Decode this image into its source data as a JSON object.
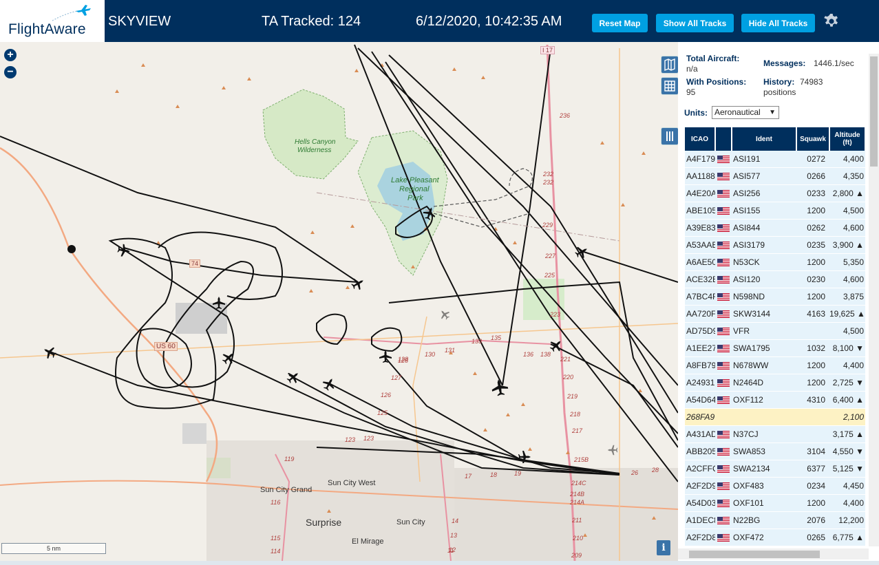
{
  "header": {
    "logo_text": "FlightAware",
    "app_name": "SKYVIEW",
    "tracked": "TA Tracked: 124",
    "datetime": "6/12/2020, 10:42:35 AM",
    "buttons": {
      "reset": "Reset Map",
      "show_all": "Show All Tracks",
      "hide_all": "Hide All Tracks"
    }
  },
  "map": {
    "zoom_in": "+",
    "zoom_out": "−",
    "scale": "5 nm",
    "info": "i",
    "labels": {
      "hells_canyon": "Hells Canyon",
      "wilderness": "Wilderness",
      "lake1": "Lake Pleasant",
      "lake2": "Regional",
      "lake3": "Park",
      "sun_city_grand": "Sun City Grand",
      "sun_city_west": "Sun City West",
      "surprise": "Surprise",
      "sun_city": "Sun City",
      "el_mirage": "El Mirage",
      "us60": "US 60",
      "i17": "I 17",
      "r74": "74"
    },
    "road_numbers": [
      "236",
      "232",
      "232",
      "229",
      "227",
      "225",
      "223",
      "221",
      "220",
      "219",
      "218",
      "217",
      "215B",
      "214C",
      "214B",
      "214A",
      "211",
      "210",
      "209",
      "131",
      "130",
      "128",
      "127",
      "126",
      "125",
      "123",
      "123",
      "135",
      "133",
      "138",
      "136",
      "119",
      "116",
      "115",
      "114",
      "17",
      "18",
      "19",
      "26",
      "28",
      "14",
      "13",
      "12",
      "11",
      "128"
    ]
  },
  "panel": {
    "total_label": "Total Aircraft:",
    "total_value": "n/a",
    "positions_label": "With Positions:",
    "positions_value": "95",
    "messages_label": "Messages:",
    "messages_value": "1446.1/sec",
    "history_label": "History:",
    "history_value": "74983",
    "history_unit": "positions",
    "units_label": "Units:",
    "units_value": "Aeronautical",
    "columns": {
      "icao": "ICAO",
      "ident": "Ident",
      "squawk": "Squawk",
      "altitude": "Altitude",
      "altitude_unit": "(ft)"
    },
    "rows": [
      {
        "icao": "A4F179",
        "ident": "ASI191",
        "squawk": "0272",
        "alt": "4,400",
        "flag": true
      },
      {
        "icao": "AA1188",
        "ident": "ASI577",
        "squawk": "0266",
        "alt": "4,350",
        "flag": true
      },
      {
        "icao": "A4E20A",
        "ident": "ASI256",
        "squawk": "0233",
        "alt": "2,800 ▲",
        "flag": true
      },
      {
        "icao": "ABE105",
        "ident": "ASI155",
        "squawk": "1200",
        "alt": "4,500",
        "flag": true
      },
      {
        "icao": "A39E83",
        "ident": "ASI844",
        "squawk": "0262",
        "alt": "4,600",
        "flag": true
      },
      {
        "icao": "A53AAE",
        "ident": "ASI3179",
        "squawk": "0235",
        "alt": "3,900 ▲",
        "flag": true
      },
      {
        "icao": "A6AE50",
        "ident": "N53CK",
        "squawk": "1200",
        "alt": "5,350",
        "flag": true
      },
      {
        "icao": "ACE32E",
        "ident": "ASI120",
        "squawk": "0230",
        "alt": "4,600",
        "flag": true
      },
      {
        "icao": "A7BC4F",
        "ident": "N598ND",
        "squawk": "1200",
        "alt": "3,875",
        "flag": true
      },
      {
        "icao": "AA720F",
        "ident": "SKW3144",
        "squawk": "4163",
        "alt": "19,625 ▲",
        "flag": true
      },
      {
        "icao": "AD75D9",
        "ident": "VFR",
        "squawk": "",
        "alt": "4,500",
        "flag": true
      },
      {
        "icao": "A1EE27",
        "ident": "SWA1795",
        "squawk": "1032",
        "alt": "8,100 ▼",
        "flag": true
      },
      {
        "icao": "A8FB79",
        "ident": "N678WW",
        "squawk": "1200",
        "alt": "4,400",
        "flag": true
      },
      {
        "icao": "A24931",
        "ident": "N2464D",
        "squawk": "1200",
        "alt": "2,725 ▼",
        "flag": true
      },
      {
        "icao": "A54D64",
        "ident": "OXF112",
        "squawk": "4310",
        "alt": "6,400 ▲",
        "flag": true
      },
      {
        "icao": "268FA9",
        "ident": "",
        "squawk": "",
        "alt": "2,100",
        "flag": false,
        "highlight": true
      },
      {
        "icao": "A431AD",
        "ident": "N37CJ",
        "squawk": "",
        "alt": "3,175 ▲",
        "flag": true
      },
      {
        "icao": "ABB205",
        "ident": "SWA853",
        "squawk": "3104",
        "alt": "4,550 ▼",
        "flag": true
      },
      {
        "icao": "A2CFFC",
        "ident": "SWA2134",
        "squawk": "6377",
        "alt": "5,125 ▼",
        "flag": true
      },
      {
        "icao": "A2F2D9",
        "ident": "OXF483",
        "squawk": "0234",
        "alt": "4,450",
        "flag": true
      },
      {
        "icao": "A54D03",
        "ident": "OXF101",
        "squawk": "1200",
        "alt": "4,400",
        "flag": true
      },
      {
        "icao": "A1DEC8",
        "ident": "N22BG",
        "squawk": "2076",
        "alt": "12,200",
        "flag": true
      },
      {
        "icao": "A2F2D8",
        "ident": "OXF472",
        "squawk": "0265",
        "alt": "6,775 ▲",
        "flag": true
      }
    ]
  },
  "colors": {
    "header_bg": "#002f5d",
    "button": "#00a0e2",
    "row_bg": "#e6f3fb",
    "highlight_row": "#fdf2c4",
    "track": "#111111",
    "lake": "#aad3df",
    "park": "#c8e6b4",
    "highway": "#e892a2"
  }
}
